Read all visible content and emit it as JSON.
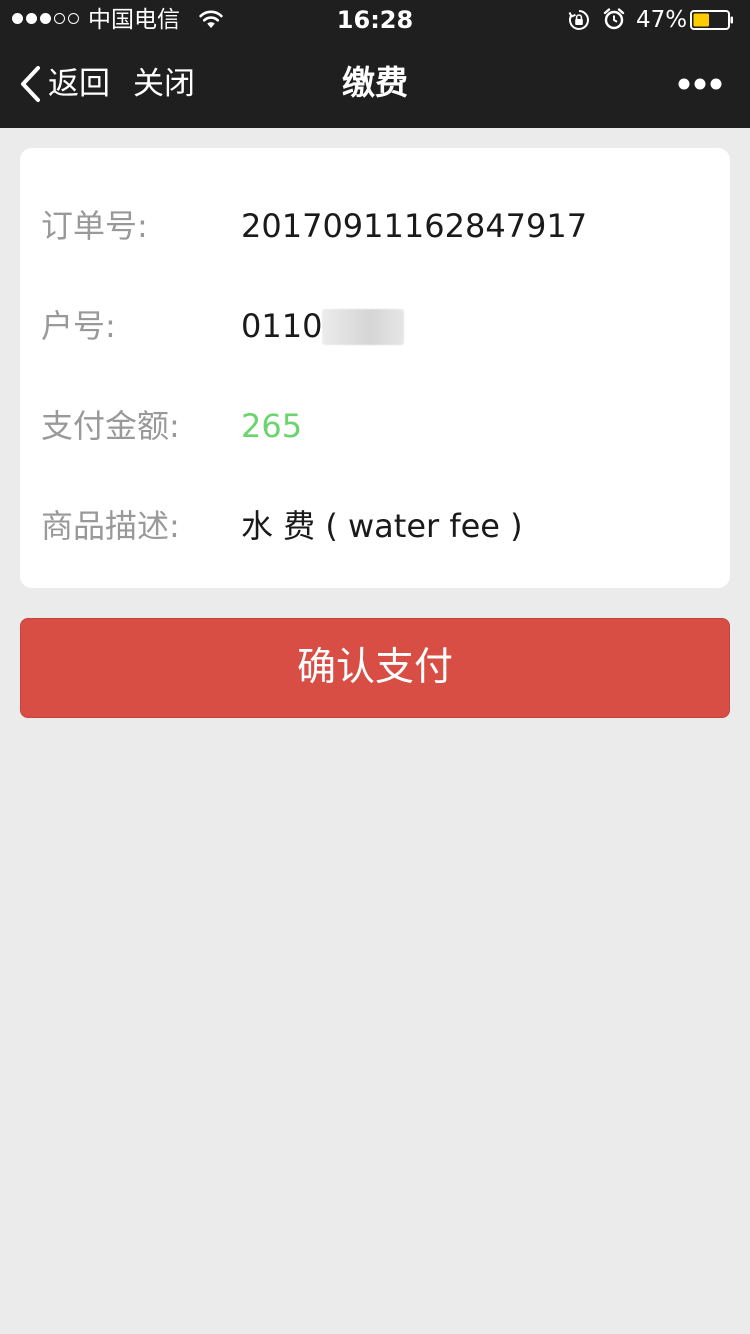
{
  "status_bar": {
    "carrier": "中国电信",
    "time": "16:28",
    "battery_percent": "47%",
    "battery_level": 0.47,
    "battery_color": "#ffcc00",
    "signal_strength": 3,
    "signal_max": 5,
    "icons": [
      "wifi-icon",
      "rotation-lock-icon",
      "alarm-icon",
      "battery-icon"
    ]
  },
  "nav": {
    "back_label": "返回",
    "close_label": "关闭",
    "title": "缴费",
    "icons": [
      "chevron-left-icon",
      "more-icon"
    ]
  },
  "order": {
    "rows": [
      {
        "label": "订单号:",
        "value": "20170911162847917"
      },
      {
        "label": "户号:",
        "value": "0110"
      },
      {
        "label": "支付金额:",
        "value": "265"
      },
      {
        "label": "商品描述:",
        "value": "水 费 ( water fee )"
      }
    ]
  },
  "confirm_label": "确认支付",
  "colors": {
    "header_bg": "#1f1f1f",
    "page_bg": "#ebebeb",
    "amount": "#6bd46e",
    "confirm_button": "#d94e44",
    "label_gray": "#999999"
  }
}
